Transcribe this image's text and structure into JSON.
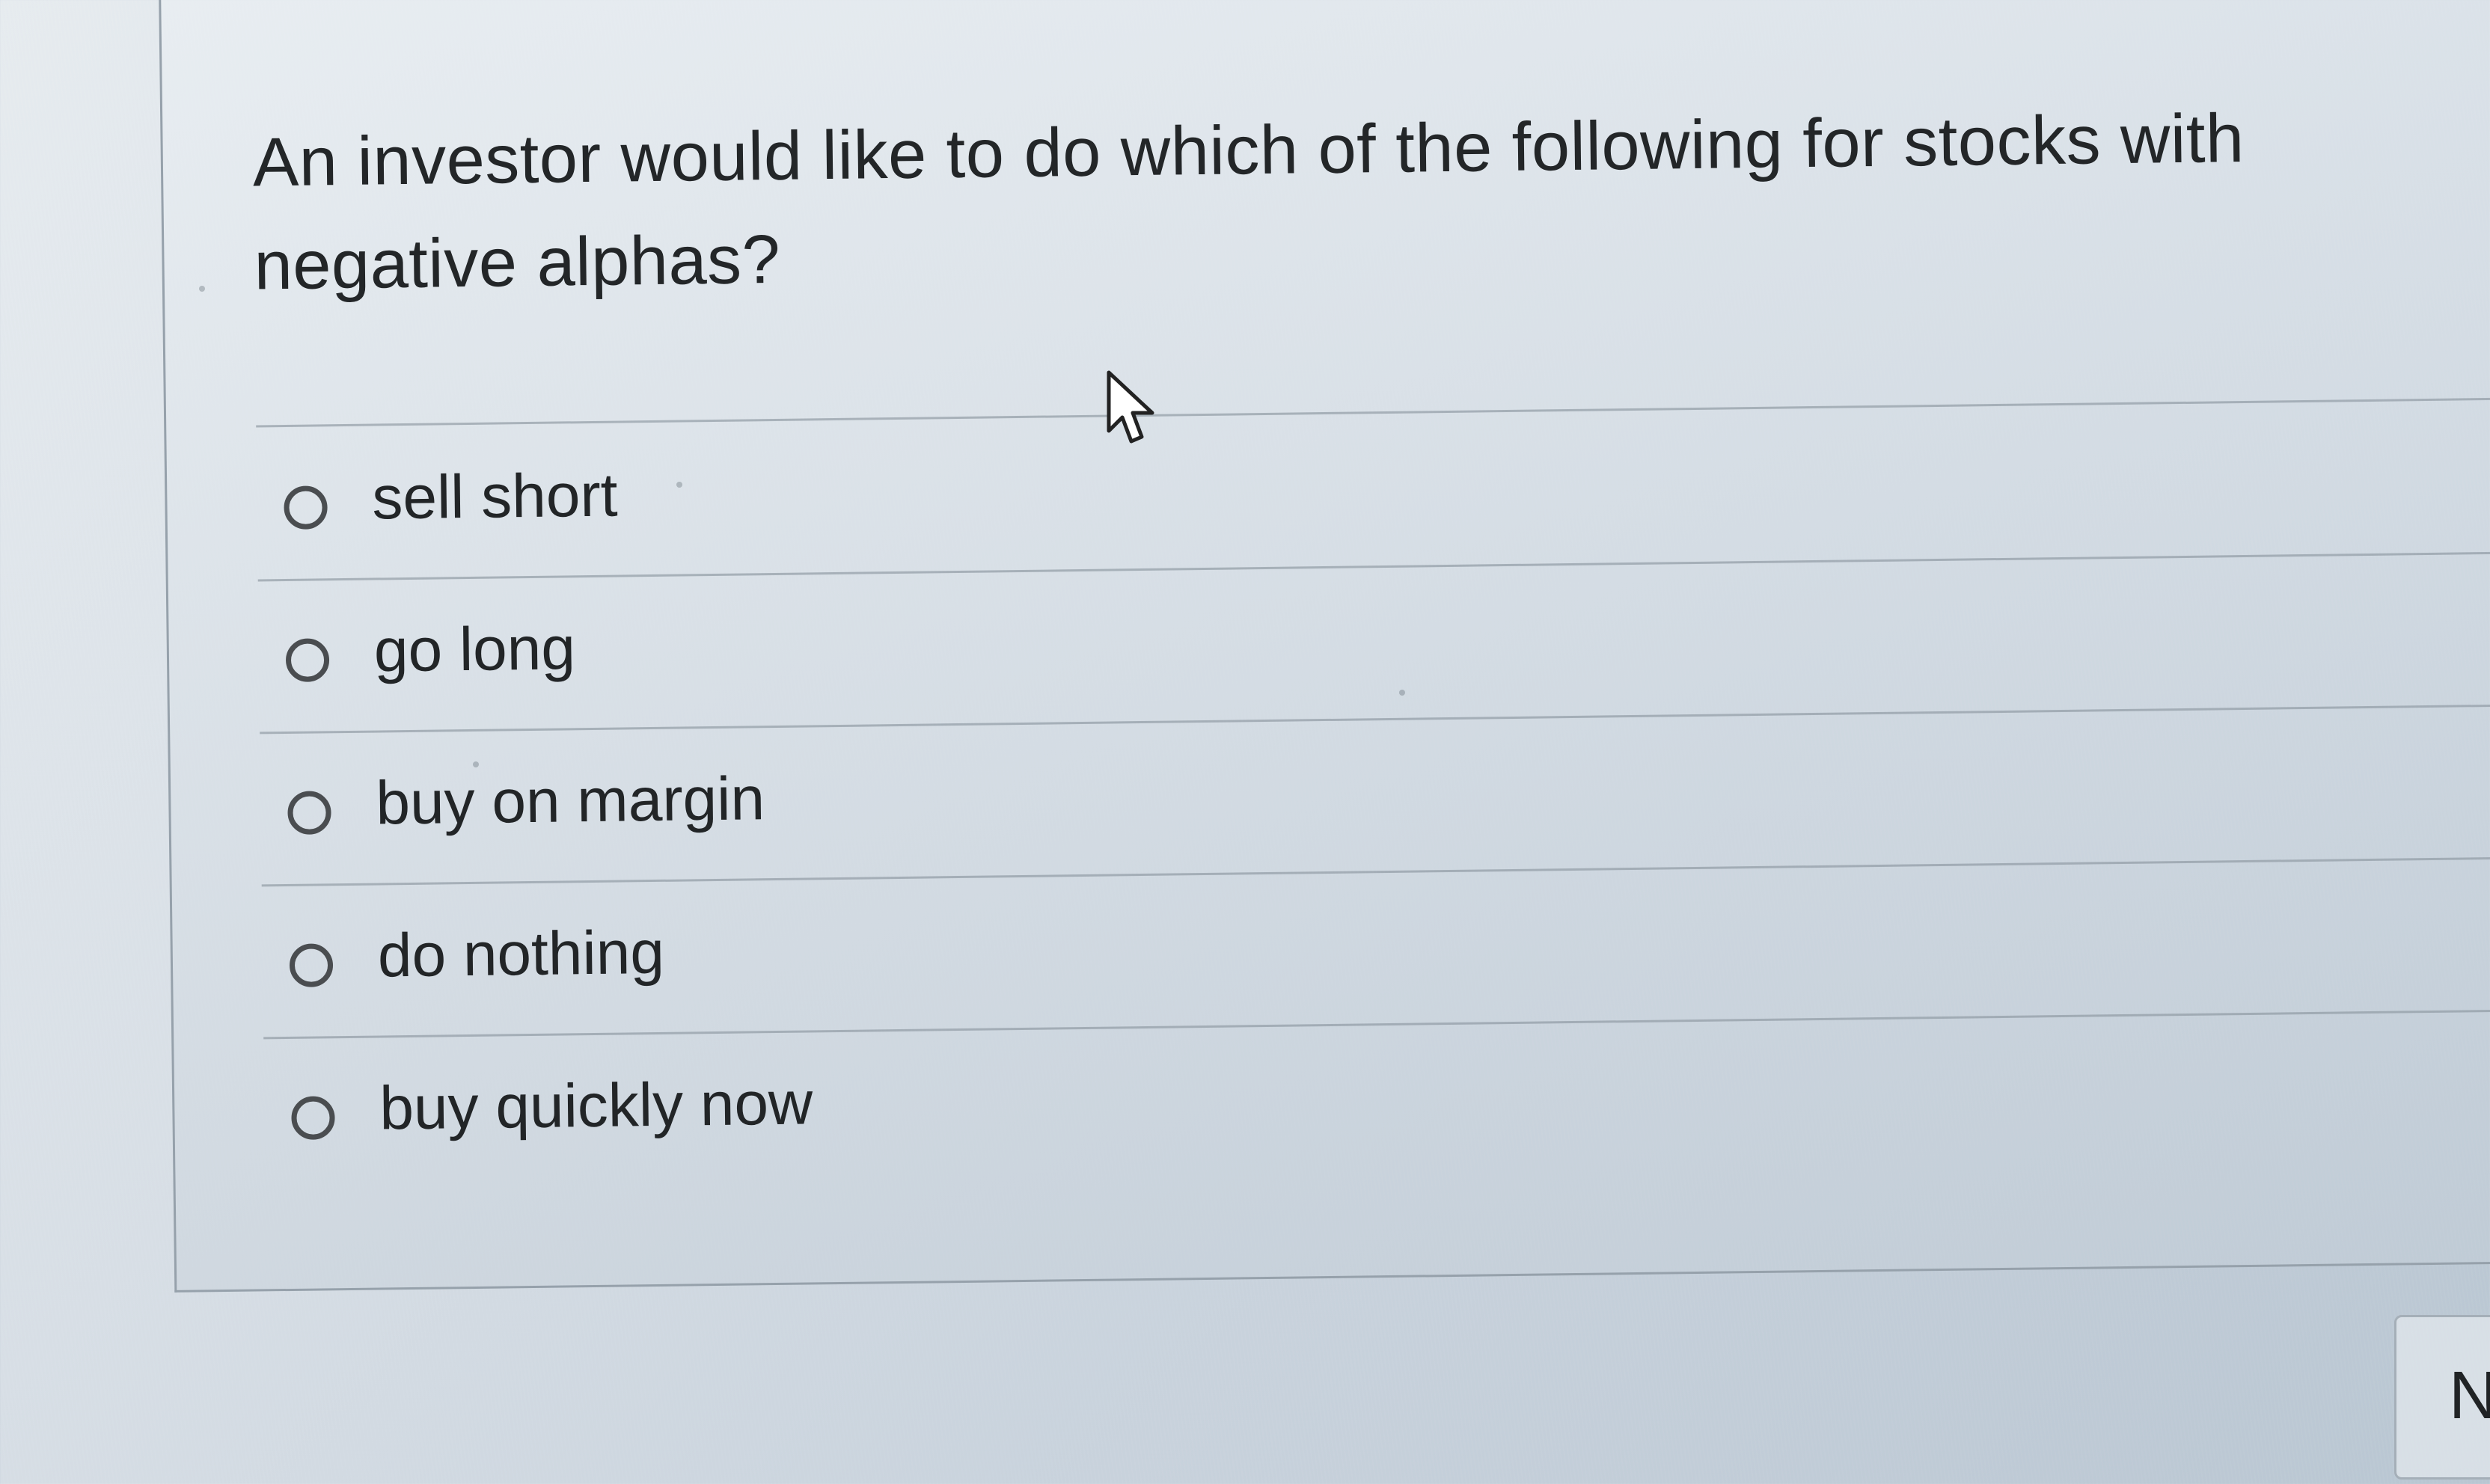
{
  "question": {
    "text": "An investor would like to do which of the following for stocks with negative alphas?"
  },
  "options": [
    {
      "label": "sell short",
      "selected": false
    },
    {
      "label": "go long",
      "selected": false
    },
    {
      "label": "buy on margin",
      "selected": false
    },
    {
      "label": "do nothing",
      "selected": false
    },
    {
      "label": "buy quickly now",
      "selected": false
    }
  ],
  "navigation": {
    "next_label": "N"
  },
  "icons": {
    "radio": "radio-button-icon",
    "cursor": "mouse-pointer-icon"
  }
}
